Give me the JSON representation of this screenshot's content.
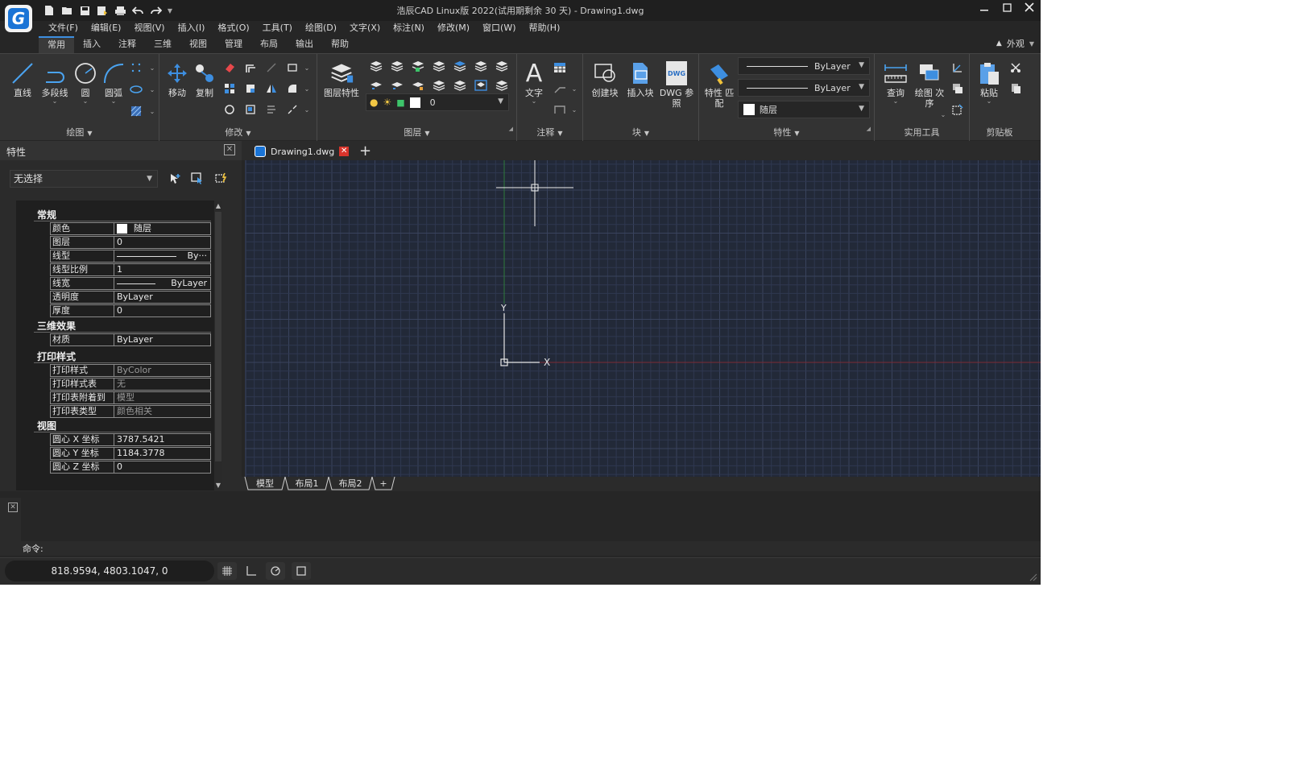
{
  "window": {
    "title": "浩辰CAD Linux版 2022(试用期剩余 30 天) - Drawing1.dwg",
    "logo_letter": "G"
  },
  "menu": [
    "文件(F)",
    "编辑(E)",
    "视图(V)",
    "插入(I)",
    "格式(O)",
    "工具(T)",
    "绘图(D)",
    "文字(X)",
    "标注(N)",
    "修改(M)",
    "窗口(W)",
    "帮助(H)"
  ],
  "ribbon_tabs": [
    "常用",
    "插入",
    "注释",
    "三维",
    "视图",
    "管理",
    "布局",
    "输出",
    "帮助"
  ],
  "appearance_label": "外观",
  "ribbon": {
    "draw": {
      "title": "绘图",
      "line": "直线",
      "polyline": "多段线",
      "circle": "圆",
      "arc": "圆弧"
    },
    "modify": {
      "title": "修改",
      "move": "移动",
      "copy": "复制"
    },
    "layer": {
      "title": "图层",
      "layer_props": "图层特性",
      "current_layer": "0"
    },
    "annotation": {
      "title": "注释",
      "text": "文字"
    },
    "block": {
      "title": "块",
      "create": "创建块",
      "insert": "插入块",
      "dwg_ref_1": "DWG 参",
      "dwg_ref_2": "照",
      "dwg_badge": "DWG"
    },
    "properties": {
      "title": "特性",
      "match_1": "特性 匹",
      "match_2": "配",
      "linetype": "ByLayer",
      "lineweight": "ByLayer",
      "color": "随层"
    },
    "utilities": {
      "title": "实用工具",
      "query": "查询",
      "draw_order_1": "绘图 次",
      "draw_order_2": "序"
    },
    "clipboard": {
      "title": "剪贴板",
      "paste": "粘贴"
    }
  },
  "properties_panel": {
    "title": "特性",
    "selection": "无选择",
    "sections": {
      "general": "常规",
      "threed": "三维效果",
      "plot": "打印样式",
      "view": "视图"
    },
    "general_rows": [
      {
        "key": "颜色",
        "value": "随层"
      },
      {
        "key": "图层",
        "value": "0"
      },
      {
        "key": "线型",
        "value": "By···"
      },
      {
        "key": "线型比例",
        "value": "1"
      },
      {
        "key": "线宽",
        "value": "ByLayer"
      },
      {
        "key": "透明度",
        "value": "ByLayer"
      },
      {
        "key": "厚度",
        "value": "0"
      }
    ],
    "threed_rows": [
      {
        "key": "材质",
        "value": "ByLayer"
      }
    ],
    "plot_rows": [
      {
        "key": "打印样式",
        "value": "ByColor"
      },
      {
        "key": "打印样式表",
        "value": "无"
      },
      {
        "key": "打印表附着到",
        "value": "模型"
      },
      {
        "key": "打印表类型",
        "value": "颜色相关"
      }
    ],
    "view_rows": [
      {
        "key": "圆心 X 坐标",
        "value": "3787.5421"
      },
      {
        "key": "圆心 Y 坐标",
        "value": "1184.3778"
      },
      {
        "key": "圆心 Z 坐标",
        "value": "0"
      }
    ]
  },
  "doc_tab": {
    "name": "Drawing1.dwg",
    "add": "+"
  },
  "canvas": {
    "axis_y": "Y",
    "axis_x": "X",
    "background": "#222938",
    "grid_color": "#2f3850",
    "grid_major_color": "#39435d"
  },
  "layout_tabs": [
    "模型",
    "布局1",
    "布局2",
    "+"
  ],
  "command": {
    "prompt": "命令:"
  },
  "status": {
    "coords": "818.9594, 4803.1047, 0"
  },
  "colors": {
    "accent": "#3d8ee0",
    "close_red": "#d9342b",
    "brand_blue": "#1a74d6"
  }
}
